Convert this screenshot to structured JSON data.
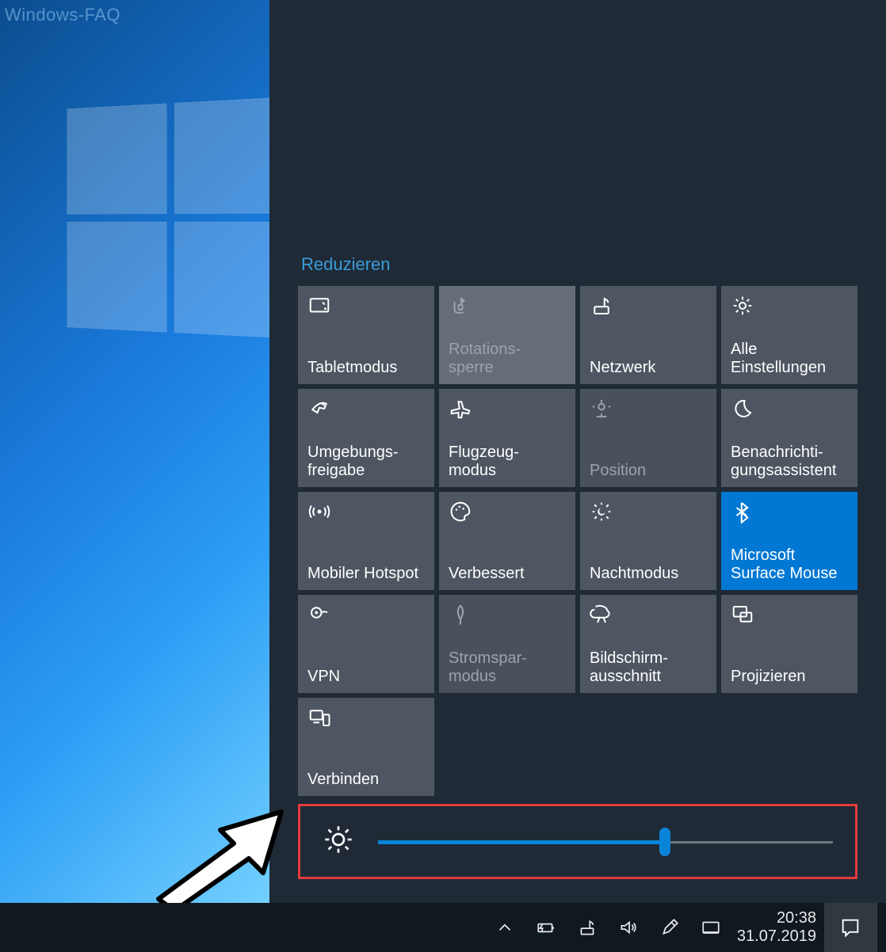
{
  "watermark": "Windows-FAQ",
  "action_center": {
    "collapse_label": "Reduzieren",
    "tiles": [
      {
        "id": "tablet-mode",
        "icon": "tablet",
        "label": "Tabletmodus",
        "state": "normal"
      },
      {
        "id": "rotation-lock",
        "icon": "rotation",
        "label": "Rotations-\nsperre",
        "state": "highlight-disabled"
      },
      {
        "id": "network",
        "icon": "network",
        "label": "Netzwerk",
        "state": "normal"
      },
      {
        "id": "all-settings",
        "icon": "gear",
        "label": "Alle Einstellungen",
        "state": "normal"
      },
      {
        "id": "nearby-share",
        "icon": "share",
        "label": "Umgebungs-\nfreigabe",
        "state": "normal"
      },
      {
        "id": "airplane",
        "icon": "airplane",
        "label": "Flugzeug-\nmodus",
        "state": "normal"
      },
      {
        "id": "location",
        "icon": "location",
        "label": "Position",
        "state": "disabled"
      },
      {
        "id": "focus-assist",
        "icon": "moon",
        "label": "Benachrichti-\ngungsassistent",
        "state": "normal"
      },
      {
        "id": "hotspot",
        "icon": "hotspot",
        "label": "Mobiler Hotspot",
        "state": "normal"
      },
      {
        "id": "enhance",
        "icon": "palette",
        "label": "Verbessert",
        "state": "normal"
      },
      {
        "id": "night-light",
        "icon": "night",
        "label": "Nachtmodus",
        "state": "normal"
      },
      {
        "id": "bluetooth",
        "icon": "bluetooth",
        "label": "Microsoft Surface Mouse",
        "state": "active"
      },
      {
        "id": "vpn",
        "icon": "vpn",
        "label": "VPN",
        "state": "normal"
      },
      {
        "id": "battery-saver",
        "icon": "leaf",
        "label": "Stromspar-\nmodus",
        "state": "disabled"
      },
      {
        "id": "snip",
        "icon": "snip",
        "label": "Bildschirm-\nausschnitt",
        "state": "normal"
      },
      {
        "id": "project",
        "icon": "project",
        "label": "Projizieren",
        "state": "normal"
      },
      {
        "id": "connect",
        "icon": "connect",
        "label": "Verbinden",
        "state": "normal"
      }
    ],
    "brightness": {
      "value": 63,
      "min": 0,
      "max": 100
    }
  },
  "taskbar": {
    "tray_icons": [
      "chevron-up",
      "battery",
      "network",
      "volume",
      "pen",
      "task-view"
    ],
    "time": "20:38",
    "date": "31.07.2019"
  }
}
